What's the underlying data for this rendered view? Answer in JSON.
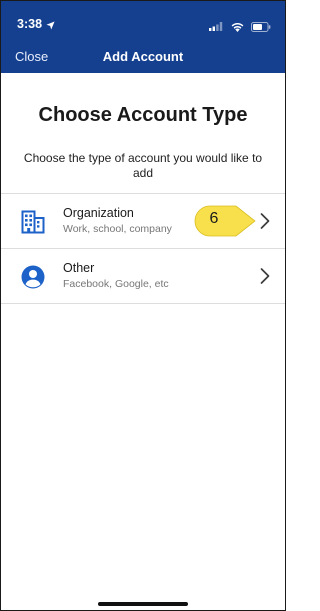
{
  "status_bar": {
    "time": "3:38",
    "location_icon": "location-arrow-icon",
    "signal_icon": "cellular-signal-icon",
    "wifi_icon": "wifi-icon",
    "battery_icon": "battery-icon"
  },
  "nav": {
    "close_label": "Close",
    "title": "Add Account"
  },
  "page": {
    "heading": "Choose Account Type",
    "subheading": "Choose the type of account you would like to add"
  },
  "account_types": [
    {
      "icon": "building-icon",
      "title": "Organization",
      "subtitle": "Work, school, company"
    },
    {
      "icon": "person-icon",
      "title": "Other",
      "subtitle": "Facebook, Google, etc"
    }
  ],
  "callout": {
    "number": "6",
    "color": "#f7e04b"
  },
  "colors": {
    "header_bg": "#15408f",
    "icon_blue": "#1d62c8"
  }
}
